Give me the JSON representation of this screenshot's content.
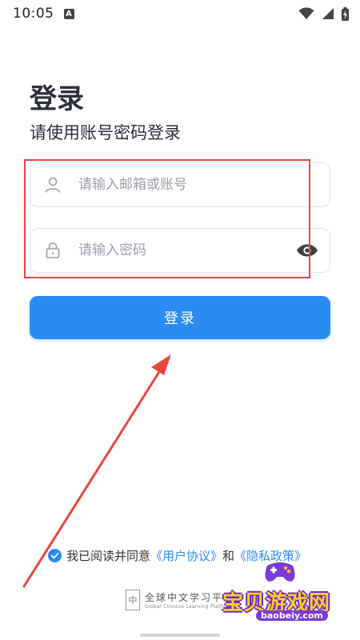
{
  "status_bar": {
    "time": "10:05",
    "notif_glyph": "A",
    "icons": [
      "wifi-icon",
      "signal-icon",
      "battery-icon"
    ]
  },
  "login": {
    "title": "登录",
    "subtitle": "请使用账号密码登录",
    "account_placeholder": "请输入邮箱或账号",
    "password_placeholder": "请输入密码",
    "button_label": "登录",
    "field_icons": [
      "user-icon",
      "lock-icon",
      "eye-icon"
    ]
  },
  "agreement": {
    "prefix": "我已阅读并同意",
    "user_agreement": "《用户协议》",
    "and": "和",
    "privacy_policy": "《隐私政策》",
    "checked": true
  },
  "brand": {
    "logo_glyph": "中",
    "name_cn": "全球中文学习平",
    "name_en": "Global Chinese Learning Platform"
  },
  "watermark": {
    "name": "宝贝游戏网",
    "url": "baobeiy.com"
  },
  "colors": {
    "accent": "#2a8bf2",
    "highlight": "#e8463d",
    "title": "#2a2f3a",
    "placeholder": "#9aa0a8"
  }
}
